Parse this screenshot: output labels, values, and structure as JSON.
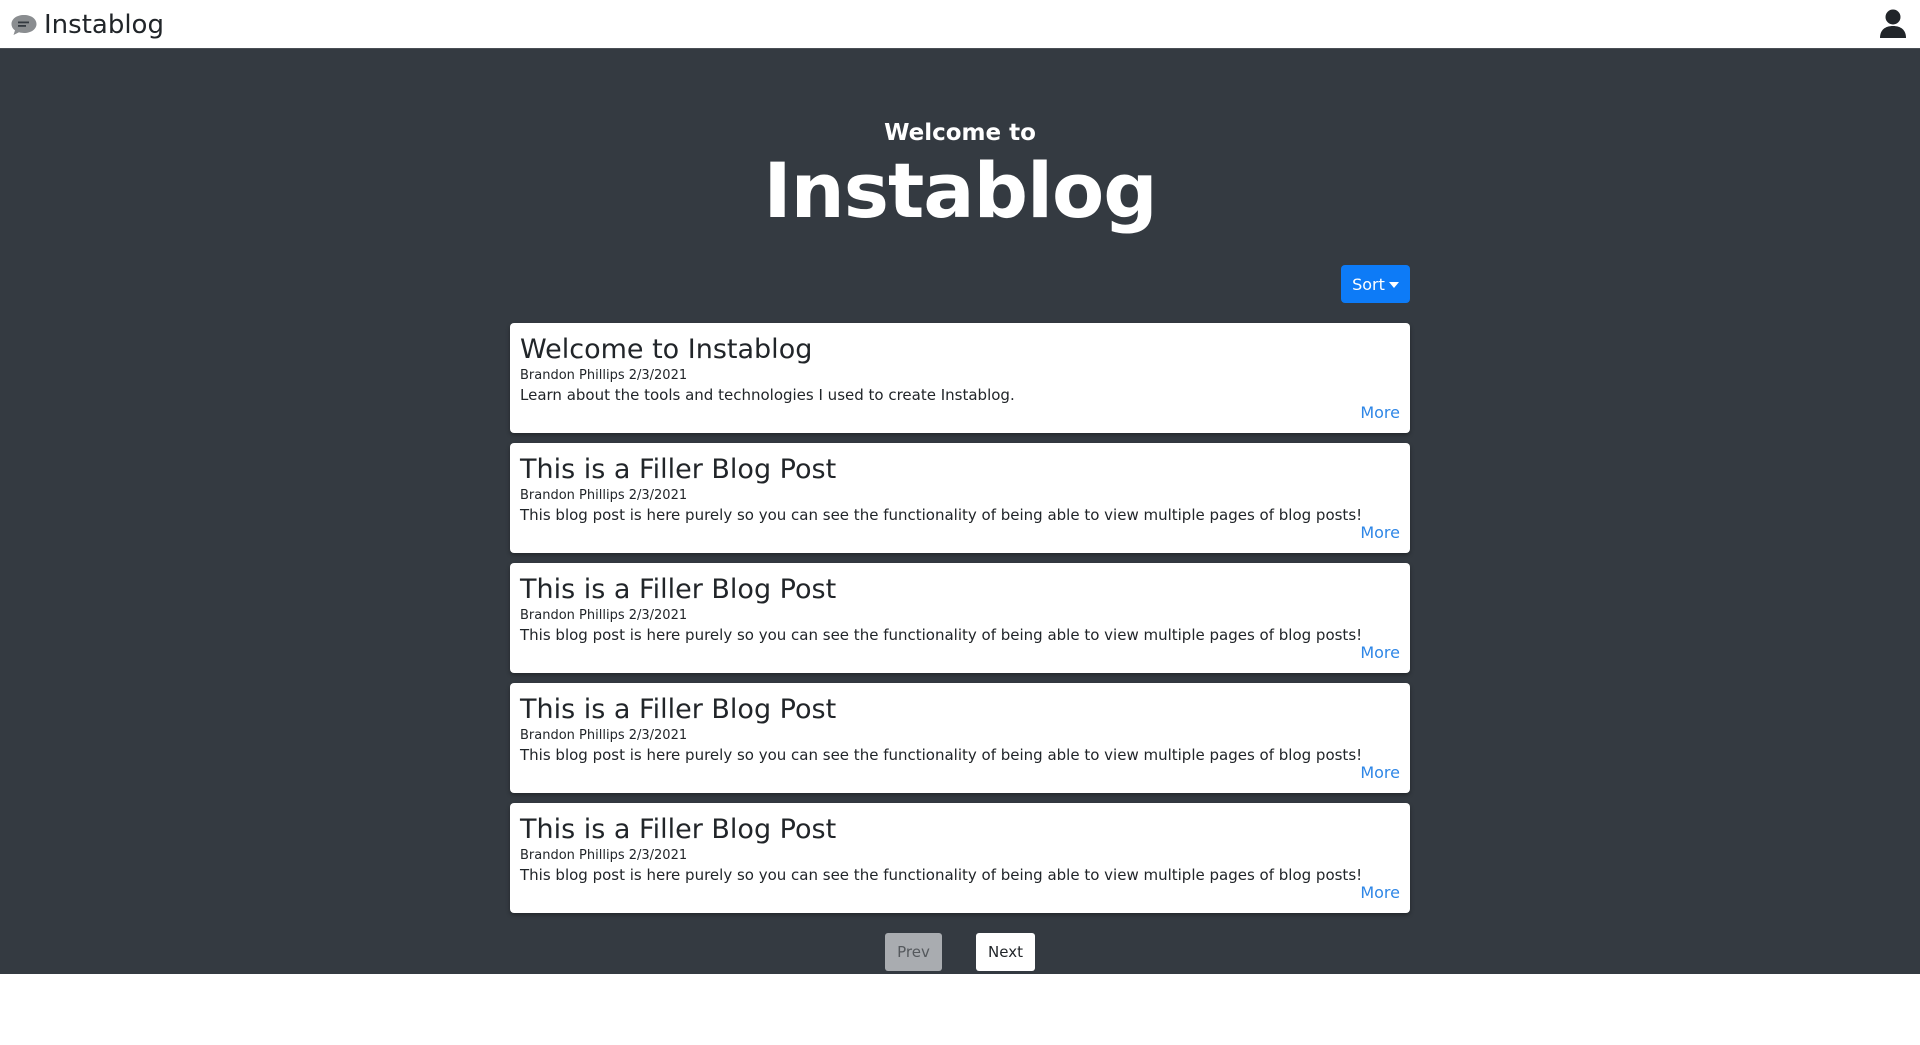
{
  "navbar": {
    "brand_text": "Instablog",
    "brand_icon": "chat-bubble-icon",
    "user_icon": "user-icon"
  },
  "hero": {
    "subtitle": "Welcome to",
    "title": "Instablog"
  },
  "sort": {
    "label": "Sort"
  },
  "posts": [
    {
      "title": "Welcome to Instablog",
      "meta": "Brandon Phillips 2/3/2021",
      "description": "Learn about the tools and technologies I used to create Instablog.",
      "more": "More"
    },
    {
      "title": "This is a Filler Blog Post",
      "meta": "Brandon Phillips 2/3/2021",
      "description": "This blog post is here purely so you can see the functionality of being able to view multiple pages of blog posts!",
      "more": "More"
    },
    {
      "title": "This is a Filler Blog Post",
      "meta": "Brandon Phillips 2/3/2021",
      "description": "This blog post is here purely so you can see the functionality of being able to view multiple pages of blog posts!",
      "more": "More"
    },
    {
      "title": "This is a Filler Blog Post",
      "meta": "Brandon Phillips 2/3/2021",
      "description": "This blog post is here purely so you can see the functionality of being able to view multiple pages of blog posts!",
      "more": "More"
    },
    {
      "title": "This is a Filler Blog Post",
      "meta": "Brandon Phillips 2/3/2021",
      "description": "This blog post is here purely so you can see the functionality of being able to view multiple pages of blog posts!",
      "more": "More"
    }
  ],
  "pagination": {
    "prev_label": "Prev",
    "next_label": "Next"
  },
  "colors": {
    "background": "#343a41",
    "accent": "#0d7bf7",
    "link": "#2e86e6"
  }
}
